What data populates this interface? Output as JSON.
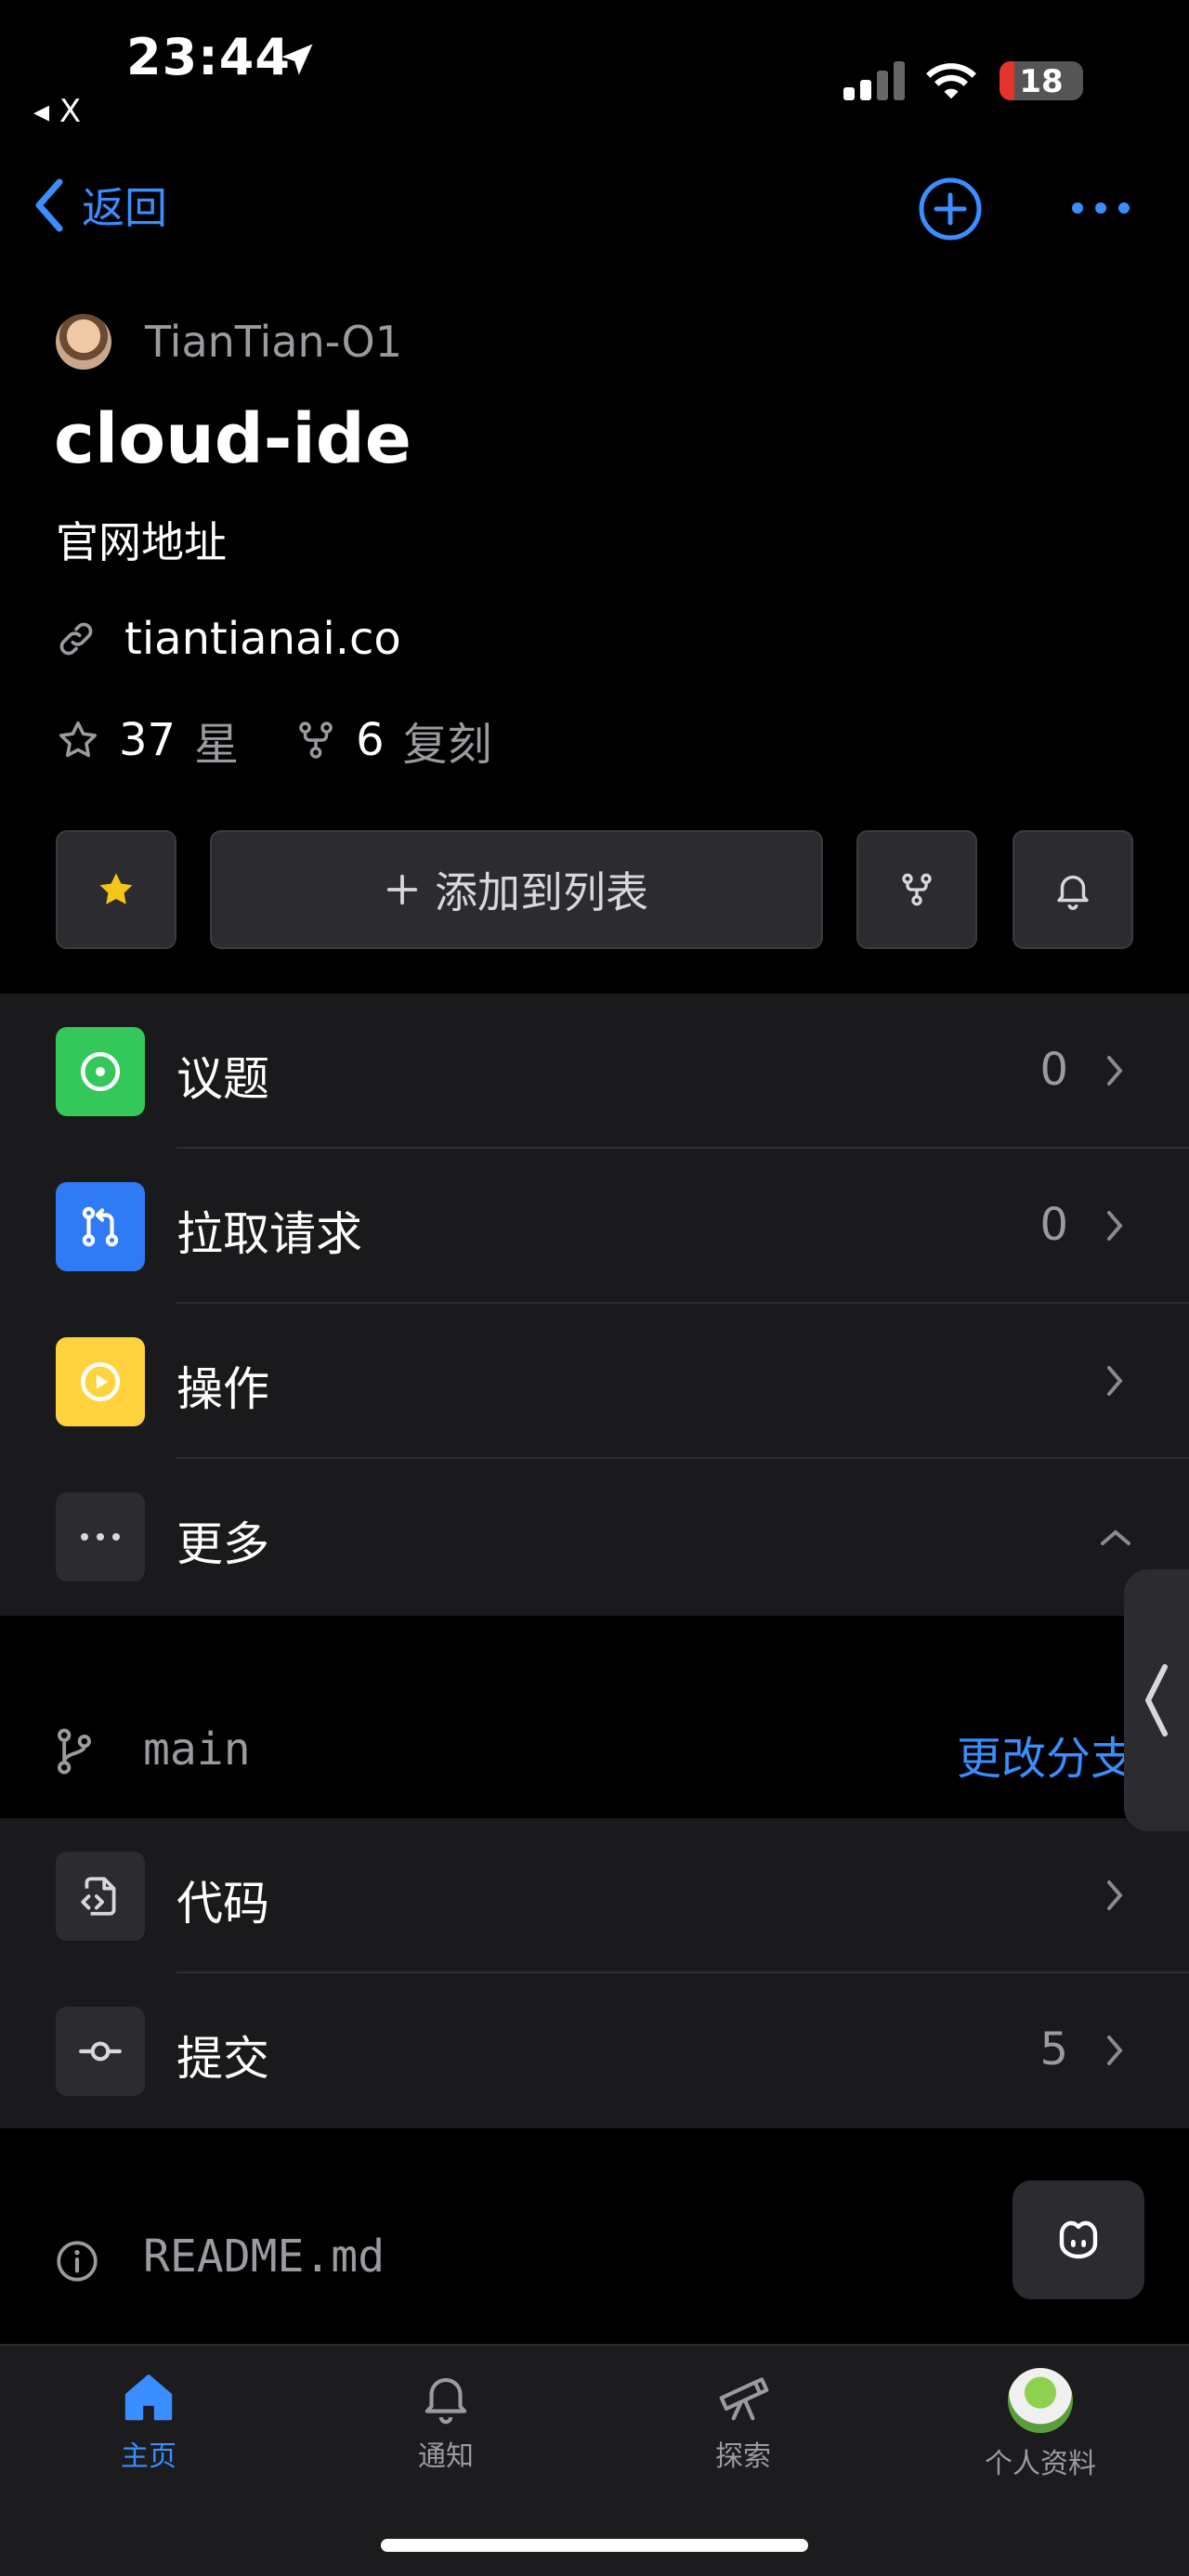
{
  "status_bar": {
    "time": "23:44",
    "back_app": "◂ X",
    "battery": "18"
  },
  "nav": {
    "back_label": "返回"
  },
  "repo": {
    "owner": "TianTian-O1",
    "name": "cloud-ide",
    "description": "官网地址",
    "website": "tiantianai.co",
    "stars_count": "37",
    "stars_label": "星",
    "forks_count": "6",
    "forks_label": "复刻"
  },
  "actions": {
    "add_to_list": "添加到列表"
  },
  "menu": [
    {
      "label": "议题",
      "count": "0",
      "icon": "issue-icon",
      "color": "#34c759"
    },
    {
      "label": "拉取请求",
      "count": "0",
      "icon": "pull-request-icon",
      "color": "#2f7bf5"
    },
    {
      "label": "操作",
      "count": "",
      "icon": "actions-play-icon",
      "color": "#ffd33d"
    },
    {
      "label": "更多",
      "count": "",
      "icon": "more-icon",
      "color": "#2c2c30"
    }
  ],
  "branch": {
    "name": "main",
    "change_label": "更改分支"
  },
  "code_menu": [
    {
      "label": "代码",
      "count": "",
      "icon": "code-file-icon"
    },
    {
      "label": "提交",
      "count": "5",
      "icon": "commit-icon"
    }
  ],
  "readme": {
    "name": "README.md"
  },
  "tabbar": [
    {
      "label": "主页",
      "icon": "home-icon",
      "active": true
    },
    {
      "label": "通知",
      "icon": "bell-icon",
      "active": false
    },
    {
      "label": "探索",
      "icon": "telescope-icon",
      "active": false
    },
    {
      "label": "个人资料",
      "icon": "profile-avatar",
      "active": false
    }
  ],
  "colors": {
    "accent": "#3a8eff",
    "background": "#000000",
    "surface": "#1a1a1d"
  }
}
